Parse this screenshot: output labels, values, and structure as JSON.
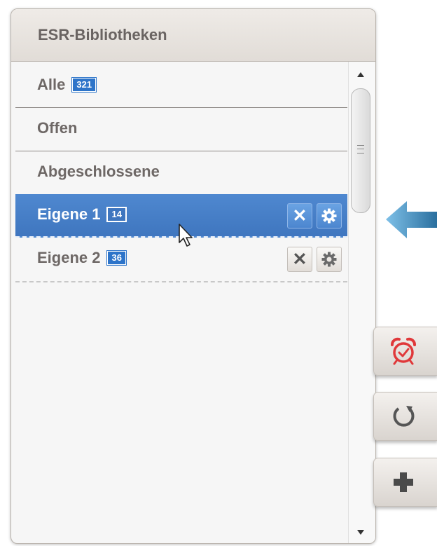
{
  "panel": {
    "title": "ESR-Bibliotheken"
  },
  "libraries": [
    {
      "label": "Alle",
      "count": "321"
    },
    {
      "label": "Offen"
    },
    {
      "label": "Abgeschlossene"
    },
    {
      "label": "Eigene 1",
      "count": "14",
      "selected": true
    },
    {
      "label": "Eigene 2",
      "count": "36"
    }
  ],
  "row_actions": {
    "delete_glyph": "✕"
  },
  "side_toolbar": [
    "alarm-clock-icon",
    "refresh-icon",
    "plus-icon"
  ],
  "colors": {
    "selection": "#4a82ca",
    "badge": "#2d74c9",
    "alarm": "#e0383a",
    "arrow": "#4a97c9"
  }
}
